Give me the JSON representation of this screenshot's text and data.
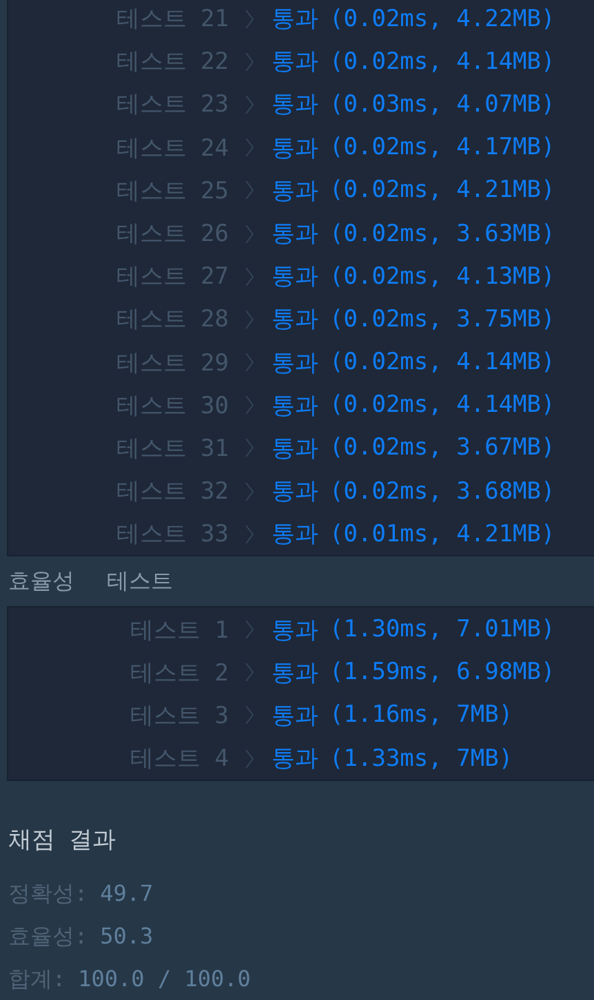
{
  "accuracy_tests": {
    "rows": [
      {
        "label": "테스트 21",
        "result": "통과",
        "detail": "(0.02ms, 4.22MB)"
      },
      {
        "label": "테스트 22",
        "result": "통과",
        "detail": "(0.02ms, 4.14MB)"
      },
      {
        "label": "테스트 23",
        "result": "통과",
        "detail": "(0.03ms, 4.07MB)"
      },
      {
        "label": "테스트 24",
        "result": "통과",
        "detail": "(0.02ms, 4.17MB)"
      },
      {
        "label": "테스트 25",
        "result": "통과",
        "detail": "(0.02ms, 4.21MB)"
      },
      {
        "label": "테스트 26",
        "result": "통과",
        "detail": "(0.02ms, 3.63MB)"
      },
      {
        "label": "테스트 27",
        "result": "통과",
        "detail": "(0.02ms, 4.13MB)"
      },
      {
        "label": "테스트 28",
        "result": "통과",
        "detail": "(0.02ms, 3.75MB)"
      },
      {
        "label": "테스트 29",
        "result": "통과",
        "detail": "(0.02ms, 4.14MB)"
      },
      {
        "label": "테스트 30",
        "result": "통과",
        "detail": "(0.02ms, 4.14MB)"
      },
      {
        "label": "테스트 31",
        "result": "통과",
        "detail": "(0.02ms, 3.67MB)"
      },
      {
        "label": "테스트 32",
        "result": "통과",
        "detail": "(0.02ms, 3.68MB)"
      },
      {
        "label": "테스트 33",
        "result": "통과",
        "detail": "(0.01ms, 4.21MB)"
      }
    ]
  },
  "efficiency_tests": {
    "title": "효율성 테스트",
    "rows": [
      {
        "label": "테스트 1",
        "result": "통과",
        "detail": "(1.30ms, 7.01MB)"
      },
      {
        "label": "테스트 2",
        "result": "통과",
        "detail": "(1.59ms, 6.98MB)"
      },
      {
        "label": "테스트 3",
        "result": "통과",
        "detail": "(1.16ms, 7MB)"
      },
      {
        "label": "테스트 4",
        "result": "통과",
        "detail": "(1.33ms, 7MB)"
      }
    ]
  },
  "grading": {
    "title": "채점 결과",
    "scores": [
      {
        "label": "정확성:",
        "value": "49.7"
      },
      {
        "label": "효율성:",
        "value": "50.3"
      },
      {
        "label": "합계:",
        "value": "100.0 / 100.0"
      }
    ]
  }
}
